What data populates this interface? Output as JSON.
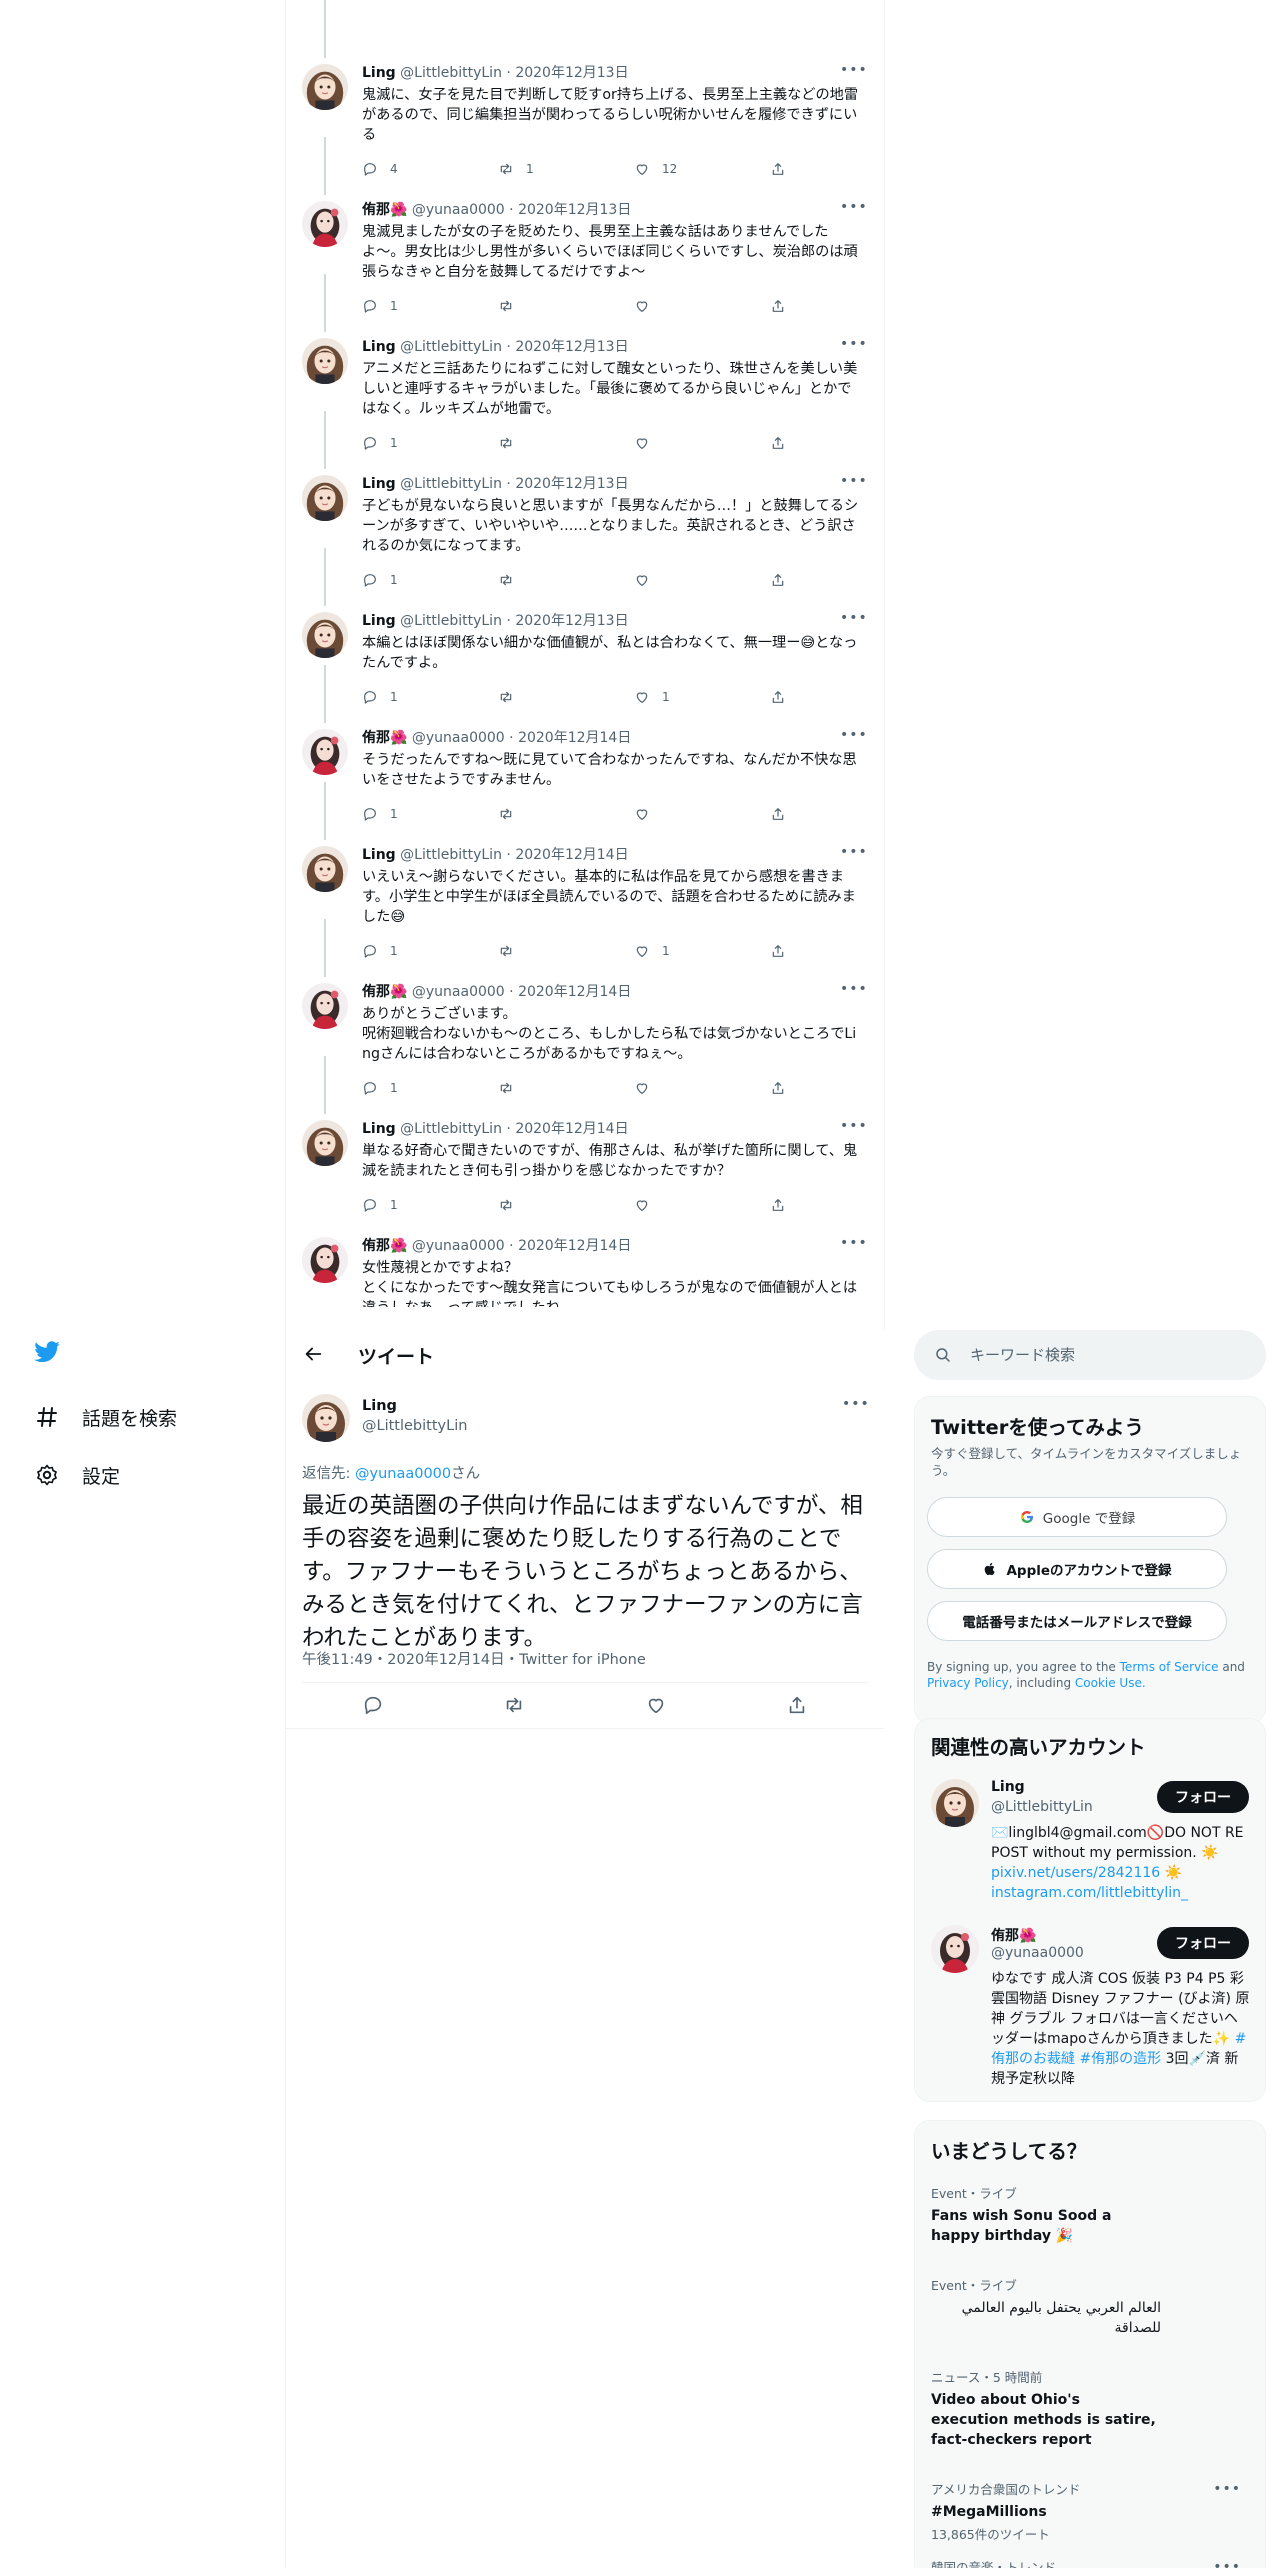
{
  "nav": {
    "explore_label": "話題を検索",
    "settings_label": "設定"
  },
  "thread": [
    {
      "name": "Ling",
      "handle": "@LittlebittyLin",
      "date": "2020年12月13日",
      "text": "鬼滅に、女子を見た目で判断して貶すor持ち上げる、長男至上主義などの地雷があるので、同じ編集担当が関わってるらしい呪術かいせんを履修できずにいる",
      "reply_count": "4",
      "retweet_count": "1",
      "like_count": "12"
    },
    {
      "name": "侑那🌺",
      "handle": "@yunaa0000",
      "date": "2020年12月13日",
      "text": "鬼滅見ましたが女の子を貶めたり、長男至上主義な話はありませんでしたよ〜。男女比は少し男性が多いくらいでほぼ同じくらいですし、炭治郎のは頑張らなきゃと自分を鼓舞してるだけですよ〜",
      "reply_count": "1",
      "retweet_count": "",
      "like_count": ""
    },
    {
      "name": "Ling",
      "handle": "@LittlebittyLin",
      "date": "2020年12月13日",
      "text": "アニメだと三話あたりにねずこに対して醜女といったり、珠世さんを美しい美しいと連呼するキャラがいました。「最後に褒めてるから良いじゃん」とかではなく。ルッキズムが地雷で。",
      "reply_count": "1",
      "retweet_count": "",
      "like_count": ""
    },
    {
      "name": "Ling",
      "handle": "@LittlebittyLin",
      "date": "2020年12月13日",
      "text": "子どもが見ないなら良いと思いますが「長男なんだから…！」と鼓舞してるシーンが多すぎて、いやいやいや……となりました。英訳されるとき、どう訳されるのか気になってます。",
      "reply_count": "1",
      "retweet_count": "",
      "like_count": ""
    },
    {
      "name": "Ling",
      "handle": "@LittlebittyLin",
      "date": "2020年12月13日",
      "text": "本編とはほぼ関係ない細かな価値観が、私とは合わなくて、無一理ー😅となったんですよ。",
      "reply_count": "1",
      "retweet_count": "",
      "like_count": "1"
    },
    {
      "name": "侑那🌺",
      "handle": "@yunaa0000",
      "date": "2020年12月14日",
      "text": "そうだったんですね〜既に見ていて合わなかったんですね、なんだか不快な思いをさせたようですみません。",
      "reply_count": "1",
      "retweet_count": "",
      "like_count": ""
    },
    {
      "name": "Ling",
      "handle": "@LittlebittyLin",
      "date": "2020年12月14日",
      "text": "いえいえ〜謝らないでください。基本的に私は作品を見てから感想を書きます。小学生と中学生がほぼ全員読んでいるので、話題を合わせるために読みました😅",
      "reply_count": "1",
      "retweet_count": "",
      "like_count": "1"
    },
    {
      "name": "侑那🌺",
      "handle": "@yunaa0000",
      "date": "2020年12月14日",
      "text": "ありがとうございます。\n呪術廻戦合わないかも〜のところ、もしかしたら私では気づかないところでLingさんには合わないところがあるかもですねぇ〜。",
      "reply_count": "1",
      "retweet_count": "",
      "like_count": ""
    },
    {
      "name": "Ling",
      "handle": "@LittlebittyLin",
      "date": "2020年12月14日",
      "text": "単なる好奇心で聞きたいのですが、侑那さんは、私が挙げた箇所に関して、鬼滅を読まれたとき何も引っ掛かりを感じなかったですか？",
      "reply_count": "1",
      "retweet_count": "",
      "like_count": ""
    },
    {
      "name": "侑那🌺",
      "handle": "@yunaa0000",
      "date": "2020年12月14日",
      "text": "女性蔑視とかですよね？\nとくになかったです〜醜女発言についてもゆしろうが鬼なので価値観が人とは違うしなあ…って感じでしたね\nなのでそういう見方もあったんだなあと思ってました〜",
      "reply_count": "",
      "retweet_count": "",
      "like_count": ""
    }
  ],
  "detail": {
    "header_title": "ツイート",
    "name": "Ling",
    "handle": "@LittlebittyLin",
    "reply_to_prefix": "返信先: ",
    "reply_to_mention": "@yunaa0000",
    "reply_to_suffix": "さん",
    "text": "最近の英語圏の子供向け作品にはまずないんですが、相手の容姿を過剰に褒めたり貶したりする行為のことです。ファフナーもそういうところがちょっとあるから、みるとき気を付けてくれ、とファフナーファンの方に言われたことがあります。",
    "meta": "午後11:49・2020年12月14日・Twitter for iPhone"
  },
  "search": {
    "placeholder": "キーワード検索"
  },
  "signup": {
    "title": "Twitterを使ってみよう",
    "subtitle": "今すぐ登録して、タイムラインをカスタマイズしましょう。",
    "google_label": "Google で登録",
    "apple_label": "Appleのアカウントで登録",
    "phone_label": "電話番号またはメールアドレスで登録",
    "terms_prefix": "By signing up, you agree to the ",
    "terms_link": "Terms of Service",
    "terms_and": " and ",
    "privacy_link": "Privacy Policy",
    "terms_including": ", including ",
    "cookie_link": "Cookie Use."
  },
  "related": {
    "title": "関連性の高いアカウント",
    "accounts": [
      {
        "name": "Ling",
        "handle": "@LittlebittyLin",
        "follow_label": "フォロー",
        "bio": "✉️linglbl4@gmail.com🚫DO NOT REPOST without my permission. ☀️",
        "link1": "pixiv.net/users/2842116 ☀️",
        "link2": "instagram.com/littlebittylin_"
      },
      {
        "name": "侑那🌺",
        "handle": "@yunaa0000",
        "follow_label": "フォロー",
        "bio": "ゆなです 成人済 COS 仮装 P3 P4 P5 彩雲国物語 Disney ファフナー (びよ済) 原神 グラブル フォロバは一言くださいヘッダーはmapoさんから頂きました✨",
        "tag1": "#侑那のお裁縫",
        "tag2": "#侑那の造形",
        "bio_tail": " 3回💉済 新規予定秋以降"
      }
    ]
  },
  "trends": {
    "title": "いまどうしてる？",
    "items": [
      {
        "context": "Event・ライブ",
        "title": "Fans wish Sonu Sood a happy birthday 🎉",
        "count": ""
      },
      {
        "context": "Event・ライブ",
        "title": "العالم العربي يحتفل باليوم العالمي للصداقة",
        "count": ""
      },
      {
        "context": "ニュース・5 時間前",
        "title": "Video about Ohio's execution methods is satire, fact-checkers report",
        "count": ""
      },
      {
        "context": "アメリカ合衆国のトレンド",
        "title": "#MegaMillions",
        "count": "13,865件のツイート"
      },
      {
        "context": "韓国の音楽・トレンド",
        "title": "",
        "count": ""
      }
    ]
  }
}
